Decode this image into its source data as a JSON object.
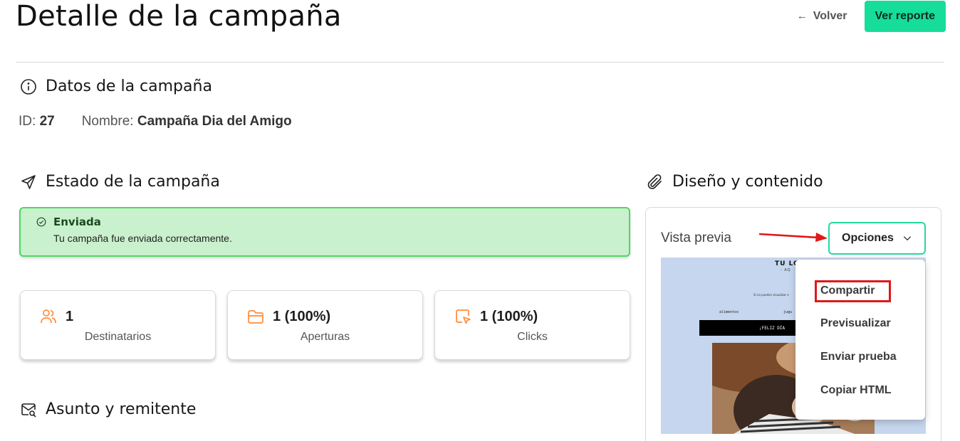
{
  "header": {
    "title": "Detalle de la campaña",
    "back_label": "Volver",
    "report_label": "Ver reporte"
  },
  "campaign_data": {
    "section_title": "Datos de la campaña",
    "id_label": "ID:",
    "id_value": "27",
    "name_label": "Nombre:",
    "name_value": "Campaña Dia del Amigo"
  },
  "status": {
    "section_title": "Estado de la campaña",
    "state": "Enviada",
    "message": "Tu campaña fue enviada correctamente.",
    "success_color": "#4ed663"
  },
  "stats": [
    {
      "icon": "users-icon",
      "value": "1",
      "label": "Destinatarios"
    },
    {
      "icon": "folder-icon",
      "value": "1 (100%)",
      "label": "Aperturas"
    },
    {
      "icon": "cursor-click-icon",
      "value": "1 (100%)",
      "label": "Clicks"
    }
  ],
  "subject": {
    "section_title": "Asunto y remitente"
  },
  "design": {
    "section_title": "Diseño y contenido",
    "preview_label": "Vista previa",
    "options_label": "Opciones",
    "options_menu": [
      "Compartir",
      "Previsualizar",
      "Enviar prueba",
      "Copiar HTML"
    ],
    "highlighted_option": "Compartir"
  },
  "email_preview": {
    "logo": "TU LO",
    "subtitle": "- AQ",
    "tiny_text": "Si no puedes visualizar e",
    "nav_1": "alimentos",
    "nav_2": "jugu",
    "banner": "¡FELIZ DÍA"
  },
  "colors": {
    "accent": "#17dd9a",
    "annotation": "#e01818"
  }
}
